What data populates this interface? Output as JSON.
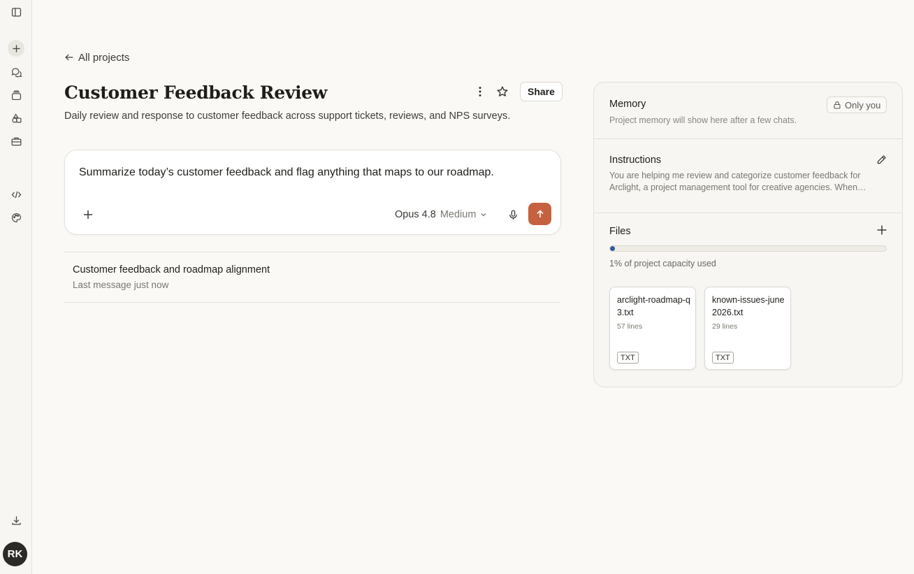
{
  "sidebar": {
    "icons": [
      "panel-toggle-icon",
      "new-chat-icon",
      "chats-icon",
      "projects-icon",
      "artifacts-icon",
      "toolbox-icon",
      "code-icon",
      "palette-icon",
      "download-icon"
    ],
    "avatar_initials": "RK"
  },
  "header": {
    "back_label": "All projects",
    "title": "Customer Feedback Review",
    "description": "Daily review and response to customer feedback across support tickets, reviews, and NPS surveys.",
    "share_label": "Share"
  },
  "composer": {
    "text": "Summarize today’s customer feedback and flag anything that maps to our roadmap.",
    "model_name": "Opus 4.8",
    "effort": "Medium",
    "accent_color": "#c6613f"
  },
  "chats": [
    {
      "title": "Customer feedback and roadmap alignment",
      "meta": "Last message just now"
    }
  ],
  "panel": {
    "memory": {
      "title": "Memory",
      "visibility_label": "Only you",
      "description": "Project memory will show here after a few chats."
    },
    "instructions": {
      "title": "Instructions",
      "line1": "You are helping me review and categorize customer feedback for",
      "line2": "Arclight, a project management tool for creative agencies. When…"
    },
    "files": {
      "title": "Files",
      "capacity_percent": 1,
      "capacity_label": "1% of project capacity used",
      "items": [
        {
          "name": "arclight-roadmap-q3.txt",
          "lines": "57 lines",
          "type": "TXT"
        },
        {
          "name": "known-issues-june2026.txt",
          "lines": "29 lines",
          "type": "TXT"
        }
      ]
    }
  }
}
